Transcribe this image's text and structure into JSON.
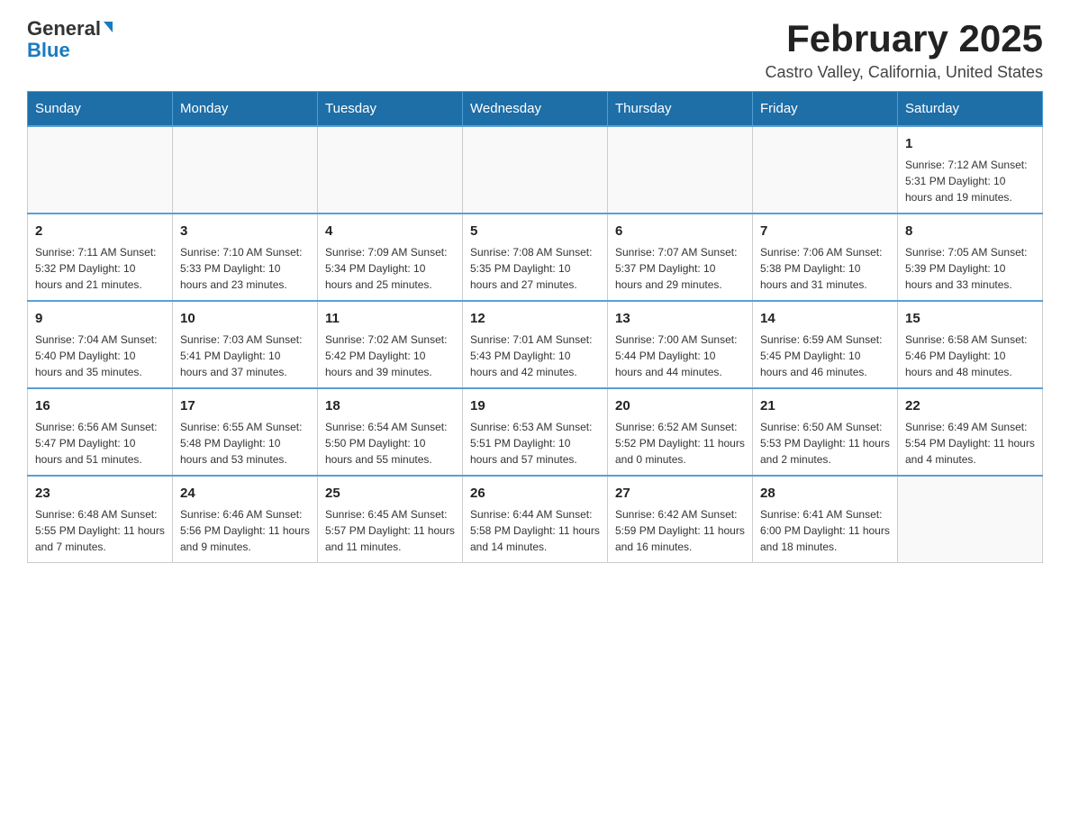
{
  "header": {
    "logo_general": "General",
    "logo_blue": "Blue",
    "month_title": "February 2025",
    "location": "Castro Valley, California, United States"
  },
  "days_of_week": [
    "Sunday",
    "Monday",
    "Tuesday",
    "Wednesday",
    "Thursday",
    "Friday",
    "Saturday"
  ],
  "weeks": [
    [
      {
        "day": "",
        "info": ""
      },
      {
        "day": "",
        "info": ""
      },
      {
        "day": "",
        "info": ""
      },
      {
        "day": "",
        "info": ""
      },
      {
        "day": "",
        "info": ""
      },
      {
        "day": "",
        "info": ""
      },
      {
        "day": "1",
        "info": "Sunrise: 7:12 AM\nSunset: 5:31 PM\nDaylight: 10 hours and 19 minutes."
      }
    ],
    [
      {
        "day": "2",
        "info": "Sunrise: 7:11 AM\nSunset: 5:32 PM\nDaylight: 10 hours and 21 minutes."
      },
      {
        "day": "3",
        "info": "Sunrise: 7:10 AM\nSunset: 5:33 PM\nDaylight: 10 hours and 23 minutes."
      },
      {
        "day": "4",
        "info": "Sunrise: 7:09 AM\nSunset: 5:34 PM\nDaylight: 10 hours and 25 minutes."
      },
      {
        "day": "5",
        "info": "Sunrise: 7:08 AM\nSunset: 5:35 PM\nDaylight: 10 hours and 27 minutes."
      },
      {
        "day": "6",
        "info": "Sunrise: 7:07 AM\nSunset: 5:37 PM\nDaylight: 10 hours and 29 minutes."
      },
      {
        "day": "7",
        "info": "Sunrise: 7:06 AM\nSunset: 5:38 PM\nDaylight: 10 hours and 31 minutes."
      },
      {
        "day": "8",
        "info": "Sunrise: 7:05 AM\nSunset: 5:39 PM\nDaylight: 10 hours and 33 minutes."
      }
    ],
    [
      {
        "day": "9",
        "info": "Sunrise: 7:04 AM\nSunset: 5:40 PM\nDaylight: 10 hours and 35 minutes."
      },
      {
        "day": "10",
        "info": "Sunrise: 7:03 AM\nSunset: 5:41 PM\nDaylight: 10 hours and 37 minutes."
      },
      {
        "day": "11",
        "info": "Sunrise: 7:02 AM\nSunset: 5:42 PM\nDaylight: 10 hours and 39 minutes."
      },
      {
        "day": "12",
        "info": "Sunrise: 7:01 AM\nSunset: 5:43 PM\nDaylight: 10 hours and 42 minutes."
      },
      {
        "day": "13",
        "info": "Sunrise: 7:00 AM\nSunset: 5:44 PM\nDaylight: 10 hours and 44 minutes."
      },
      {
        "day": "14",
        "info": "Sunrise: 6:59 AM\nSunset: 5:45 PM\nDaylight: 10 hours and 46 minutes."
      },
      {
        "day": "15",
        "info": "Sunrise: 6:58 AM\nSunset: 5:46 PM\nDaylight: 10 hours and 48 minutes."
      }
    ],
    [
      {
        "day": "16",
        "info": "Sunrise: 6:56 AM\nSunset: 5:47 PM\nDaylight: 10 hours and 51 minutes."
      },
      {
        "day": "17",
        "info": "Sunrise: 6:55 AM\nSunset: 5:48 PM\nDaylight: 10 hours and 53 minutes."
      },
      {
        "day": "18",
        "info": "Sunrise: 6:54 AM\nSunset: 5:50 PM\nDaylight: 10 hours and 55 minutes."
      },
      {
        "day": "19",
        "info": "Sunrise: 6:53 AM\nSunset: 5:51 PM\nDaylight: 10 hours and 57 minutes."
      },
      {
        "day": "20",
        "info": "Sunrise: 6:52 AM\nSunset: 5:52 PM\nDaylight: 11 hours and 0 minutes."
      },
      {
        "day": "21",
        "info": "Sunrise: 6:50 AM\nSunset: 5:53 PM\nDaylight: 11 hours and 2 minutes."
      },
      {
        "day": "22",
        "info": "Sunrise: 6:49 AM\nSunset: 5:54 PM\nDaylight: 11 hours and 4 minutes."
      }
    ],
    [
      {
        "day": "23",
        "info": "Sunrise: 6:48 AM\nSunset: 5:55 PM\nDaylight: 11 hours and 7 minutes."
      },
      {
        "day": "24",
        "info": "Sunrise: 6:46 AM\nSunset: 5:56 PM\nDaylight: 11 hours and 9 minutes."
      },
      {
        "day": "25",
        "info": "Sunrise: 6:45 AM\nSunset: 5:57 PM\nDaylight: 11 hours and 11 minutes."
      },
      {
        "day": "26",
        "info": "Sunrise: 6:44 AM\nSunset: 5:58 PM\nDaylight: 11 hours and 14 minutes."
      },
      {
        "day": "27",
        "info": "Sunrise: 6:42 AM\nSunset: 5:59 PM\nDaylight: 11 hours and 16 minutes."
      },
      {
        "day": "28",
        "info": "Sunrise: 6:41 AM\nSunset: 6:00 PM\nDaylight: 11 hours and 18 minutes."
      },
      {
        "day": "",
        "info": ""
      }
    ]
  ]
}
